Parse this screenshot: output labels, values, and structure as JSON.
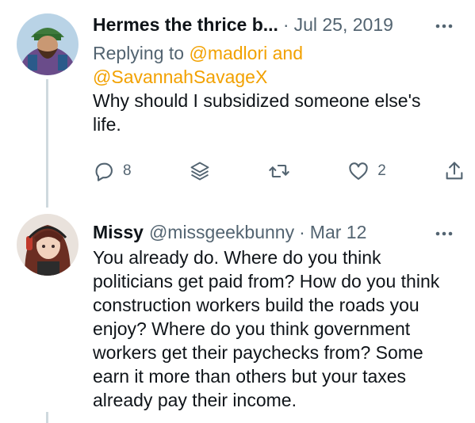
{
  "tweets": [
    {
      "name": "Hermes the thrice b...",
      "handle": "",
      "separator": "·",
      "time": "Jul 25, 2019",
      "reply_prefix": "Replying to ",
      "reply_mention_1": "@madlori and",
      "reply_mention_2": "@SavannahSavageX",
      "text_lines": [
        "Why should I subsidized someone else's",
        "life."
      ],
      "actions": {
        "reply_count": "8",
        "like_count": "2"
      },
      "avatar_icon": "avatar-bearded-man-turban"
    },
    {
      "name": "Missy",
      "handle": "@missgeekbunny",
      "separator": "·",
      "time": "Mar 12",
      "text_lines": [
        "You already do. Where do you think",
        "politicians get paid from? How do you think",
        "construction workers build the roads you",
        "enjoy? Where do you think government",
        "workers get their paychecks from? Some",
        "earn it more than others but your taxes",
        "already pay their income."
      ],
      "avatar_icon": "avatar-anime-girl-headphones"
    }
  ],
  "colors": {
    "mention": "#f2a100",
    "secondary_text": "#536471",
    "thread_line": "#cfd9de"
  }
}
